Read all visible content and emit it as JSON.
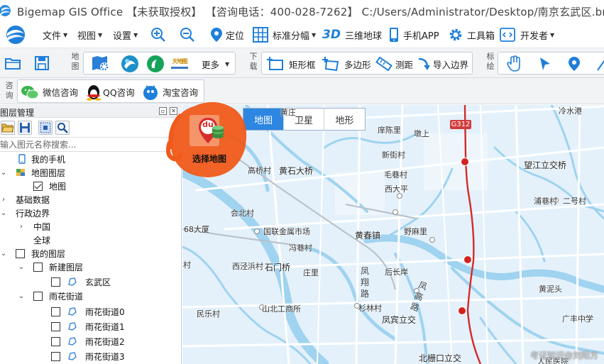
{
  "window": {
    "title": "Bigemap GIS Office 【未获取授权】 【咨询电话：400-028-7262】 C:/Users/Administrator/Desktop/南京玄武区.bmv"
  },
  "menu": {
    "file": "文件",
    "view": "视图",
    "settings": "设置",
    "locate": "定位",
    "standard_grid": "标准分幅",
    "three_d_icon": "3D",
    "three_d_globe": "三维地球",
    "mobile_app": "手机APP",
    "toolbox": "工具箱",
    "developer": "开发者"
  },
  "toolbar": {
    "map_group_label": "地图",
    "more": "更多",
    "download_group_label": "下载",
    "rect": "矩形框",
    "polygon": "多边形",
    "measure": "测距",
    "import_boundary": "导入边界",
    "annotate_group_label": "标绘",
    "logo_label": "天地图"
  },
  "consult": {
    "group_label": "咨询",
    "wechat": "微信咨询",
    "qq": "QQ咨询",
    "taobao": "淘宝咨询"
  },
  "panel": {
    "title": "图层管理",
    "search_placeholder": "输入图元名称搜索...",
    "tree": {
      "my_phone": "我的手机",
      "map_layer": "地图图层",
      "map": "地图",
      "basic_data": "基础数据",
      "admin_boundary": "行政边界",
      "china": "中国",
      "global": "全球",
      "my_layers": "我的图层",
      "new_layer": "新建图层",
      "xuanwu": "玄武区",
      "yuhua_street": "雨花街道",
      "yh0": "雨花街道0",
      "yh1": "雨花街道1",
      "yh2": "雨花街道2",
      "yh3": "雨花街道3"
    }
  },
  "map": {
    "tabs": [
      "地图",
      "卫星",
      "地形"
    ],
    "active_tab": "地图",
    "choose_map_label": "选择地图",
    "choose_map_badge": "du",
    "shield": "G312",
    "labels": {
      "huangtuo": "黄庄",
      "gaoqiaocun": "高桥村",
      "huangshi": "黄石大桥",
      "kuchenli": "庠陈里",
      "dunshang": "墩上",
      "xinjiancun": "新街村",
      "maoxiang": "毛巷村",
      "xidaping": "西大平",
      "wangjiang": "望江立交桥",
      "puxiang": "浦巷村",
      "erhao": "二号村",
      "huibei": "会北村",
      "guolian": "国联金属市场",
      "feng": "冯巷村",
      "huangchun": "黄春镇",
      "yemaoli": "野麻里",
      "da68": "68大厦",
      "xicha": "西泾浜村",
      "shimen": "石门桥",
      "zhuangli": "庄里",
      "houchang": "后长岸",
      "huangni": "黄泥头",
      "village_l": "村",
      "minhuo": "民乐村",
      "shanbei": "山北工商所",
      "shanlin": "杉林村",
      "fengbin": "凤宾立交",
      "guangzhong": "广丰中学",
      "beizha": "北栅口立交",
      "people_hosp": "人民医院",
      "coldwater": "冷水港",
      "fengxiang": "凤翔路",
      "fenggao": "凤高路"
    },
    "watermark": "考证知识@刘阳方"
  }
}
